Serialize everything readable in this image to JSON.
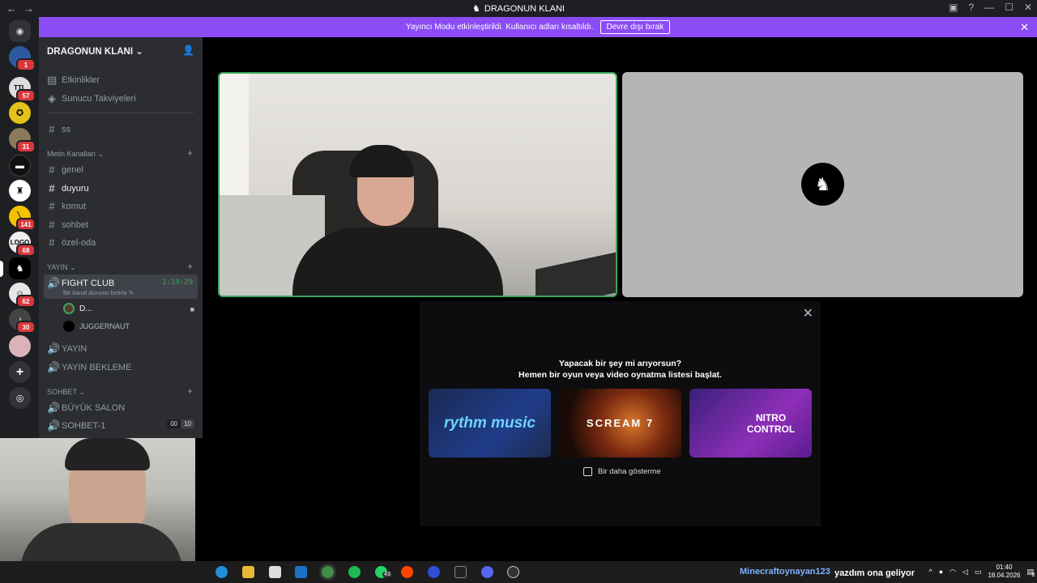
{
  "titlebar": {
    "title": "DRAGONUN KLANI",
    "back": "←",
    "forward": "→"
  },
  "banner": {
    "message": "Yayıncı Modu etkinleştirildi. Kullanıcı adları kısaltıldı.",
    "button": "Devre dışı bırak"
  },
  "servers": [
    {
      "badge": "1"
    },
    {
      "badge": "57"
    },
    {
      "badge": ""
    },
    {
      "badge": "31"
    },
    {
      "badge": ""
    },
    {
      "badge": ""
    },
    {
      "badge": "141"
    },
    {
      "badge": "68"
    },
    {
      "badge": ""
    },
    {
      "badge": "62"
    },
    {
      "badge": "30"
    },
    {
      "badge": ""
    }
  ],
  "sidebar": {
    "server_name": "DRAGONUN KLANI",
    "top_items": [
      "Etkinlikler",
      "Sunucu Takviyeleri"
    ],
    "pinned_channel": "ss",
    "text_category": "Metin Kanalları",
    "text_channels": [
      "genel",
      "duyuru",
      "komut",
      "sohbet",
      "özel-oda"
    ],
    "voice_category": "YAYIN",
    "active_voice": {
      "name": "FIGHT CLUB",
      "timer": "1:19:29",
      "status": "Bir kanal durumu belirle"
    },
    "voice_users": [
      "D...",
      "JUGGERNAUT"
    ],
    "voice_channels": [
      "YAYIN",
      "YAYIN BEKLEME"
    ],
    "chat_category": "SOHBET",
    "chat_channels": [
      "BÜYÜK SALON",
      "SOHBET-1"
    ],
    "sohbet1_counts": [
      "00",
      "10"
    ]
  },
  "activity": {
    "title": "Yapacak bir şey mi arıyorsun?",
    "subtitle": "Hemen bir oyun veya video oynatma listesi başlat.",
    "cards": [
      "rythm music",
      "SCREAM 7",
      "NITRO CONTROL"
    ],
    "checkbox": "Bir daha gösterme"
  },
  "taskbar": {
    "ticker": "Minecraftoynayan123",
    "ticker2": "yazdım ona geliyor",
    "whatsapp_badge": "43",
    "time": "01:40",
    "date": "18.04.2026",
    "notif": "8"
  }
}
